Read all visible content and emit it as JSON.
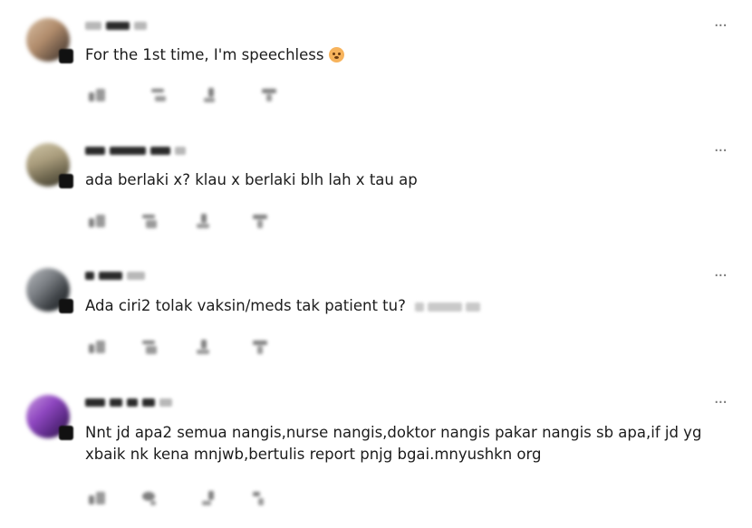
{
  "comments": [
    {
      "id": "c1",
      "text": "For the 1st time, I'm speechless",
      "has_emoji": true,
      "emoji_icon": "flushed-face-emoji",
      "avatar_colors": [
        "#c9a98a",
        "#5a4a3a"
      ]
    },
    {
      "id": "c2",
      "text": "ada berlaki x? klau x berlaki blh lah x tau ap",
      "has_emoji": false,
      "avatar_colors": [
        "#b9ad8f",
        "#4f4a3c"
      ]
    },
    {
      "id": "c3",
      "text": "Ada ciri2 tolak vaksin/meds tak patient tu?",
      "has_emoji": false,
      "avatar_colors": [
        "#8c8f93",
        "#2f3336"
      ]
    },
    {
      "id": "c4",
      "text": "Nnt jd apa2 semua nangis,nurse nangis,doktor nangis pakar nangis sb apa,if jd yg xbaik nk kena mnjwb,bertulis report pnjg bgai.mnyushkn org",
      "has_emoji": false,
      "avatar_colors": [
        "#7a3fa8",
        "#3a1f55"
      ]
    }
  ],
  "more_label": "···",
  "icons": {
    "more": "more-options-icon",
    "like": "like-icon",
    "reply": "reply-icon",
    "share": "share-icon",
    "reaction": "reaction-icon"
  }
}
